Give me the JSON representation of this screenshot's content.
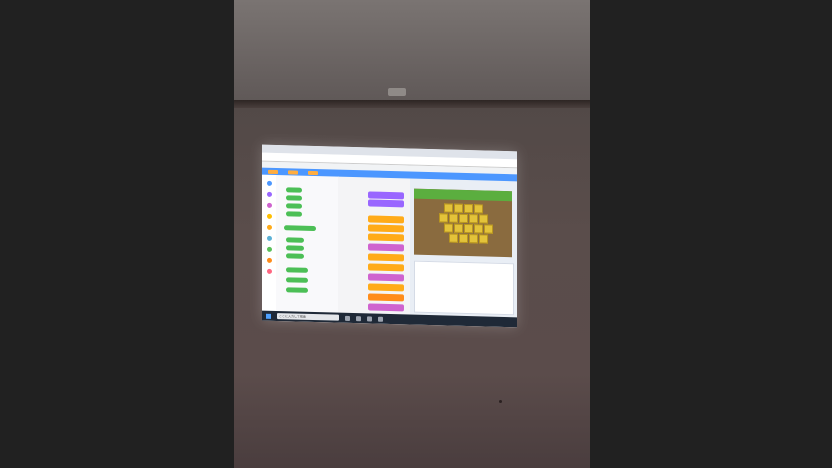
{
  "scene": {
    "description_colors": {
      "letterbox": "#212121",
      "wall": "#5a4d4b",
      "ceiling": "#7a7472",
      "projected_screen": "#f3f4f6",
      "scratch_blue": "#4c97ff",
      "stage_grass": "#5bae3f",
      "tile_yellow": "#e3c33a"
    }
  },
  "projection": {
    "browser_tabs": [
      "",
      ""
    ],
    "bookmarks": [
      "",
      "",
      "",
      "",
      ""
    ],
    "menu": [
      "",
      "",
      ""
    ],
    "taskbar_search": "ここに入力して検索"
  }
}
